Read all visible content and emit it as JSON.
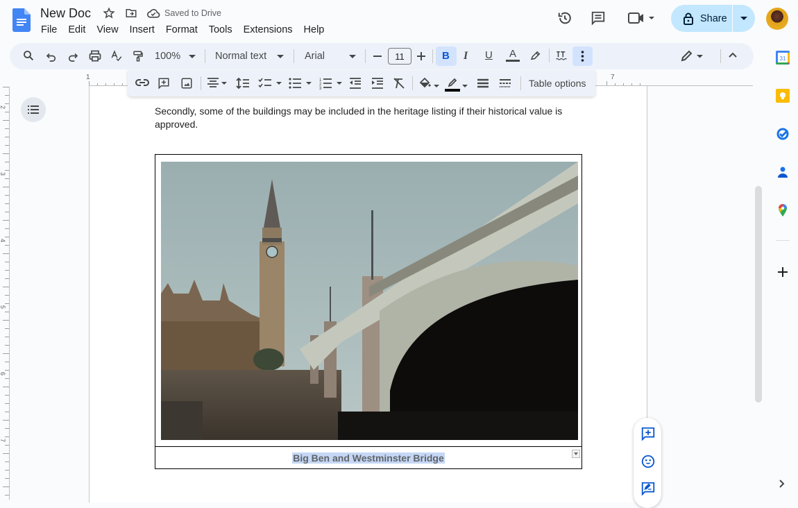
{
  "app": {
    "name": "Google Docs"
  },
  "header": {
    "title": "New Doc",
    "save_status": "Saved to Drive",
    "menu": [
      "File",
      "Edit",
      "View",
      "Insert",
      "Format",
      "Tools",
      "Extensions",
      "Help"
    ],
    "share_label": "Share",
    "icons": [
      "star-icon",
      "move-to-folder-icon",
      "cloud-saved-icon",
      "version-history-icon",
      "comments-icon",
      "meet-icon",
      "lock-icon",
      "avatar"
    ]
  },
  "toolbar": {
    "zoom": "100%",
    "style": "Normal text",
    "font": "Arial",
    "font_size": "11",
    "bold_active": true,
    "more_active": true,
    "mode_icon": "pencil-icon"
  },
  "table_toolbar": {
    "table_options_label": "Table options"
  },
  "ruler": {
    "horizontal_labels": [
      "1",
      "7"
    ],
    "vertical_labels": [
      "2",
      "3",
      "4",
      "5",
      "6",
      "7"
    ]
  },
  "document": {
    "paragraph": "Secondly, some of the buildings may be included in the heritage listing if their historical value is approved.",
    "table": {
      "image_alt": "Big Ben and Westminster Bridge photo",
      "caption": "Big Ben and Westminster Bridge"
    }
  },
  "side_panel": {
    "apps": [
      "calendar-icon",
      "keep-icon",
      "tasks-icon",
      "contacts-icon",
      "maps-icon"
    ],
    "calendar_day": "31"
  },
  "colors": {
    "accent": "#0b57d0",
    "share_bg": "#c2e7ff",
    "toolbar_bg": "#edf2fa",
    "active_btn": "#d3e3fd",
    "selection": "#c5d7f5"
  }
}
